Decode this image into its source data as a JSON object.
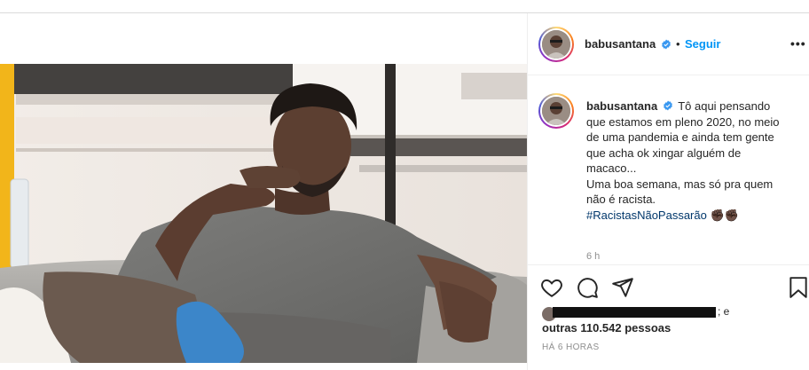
{
  "author": {
    "username": "babusantana",
    "verified": true,
    "follow_label": "Seguir",
    "separator": "•"
  },
  "caption": {
    "username": "babusantana",
    "lines": [
      "Tô aqui pensando",
      "que estamos em pleno 2020, no meio",
      "de uma pandemia e ainda tem gente",
      "que acha ok xingar alguém de",
      "macaco...",
      "Uma boa semana, mas só pra quem",
      "não é racista."
    ],
    "hashtag": "#RacistasNãoPassarão",
    "emoji": "✊🏿✊🏿"
  },
  "time_ago": "6 h",
  "likes": {
    "and_text": "; e",
    "others_text": "outras 110.542 pessoas"
  },
  "posted": "HÁ 6 HORAS",
  "icons": {
    "options": "more-options-icon",
    "like": "heart-icon",
    "comment": "comment-icon",
    "share": "share-icon",
    "save": "bookmark-icon",
    "badge": "verified-badge-icon"
  },
  "colors": {
    "accent": "#0095f6",
    "hashtag": "#00376b",
    "muted": "#8e8e8e",
    "text": "#262626"
  }
}
